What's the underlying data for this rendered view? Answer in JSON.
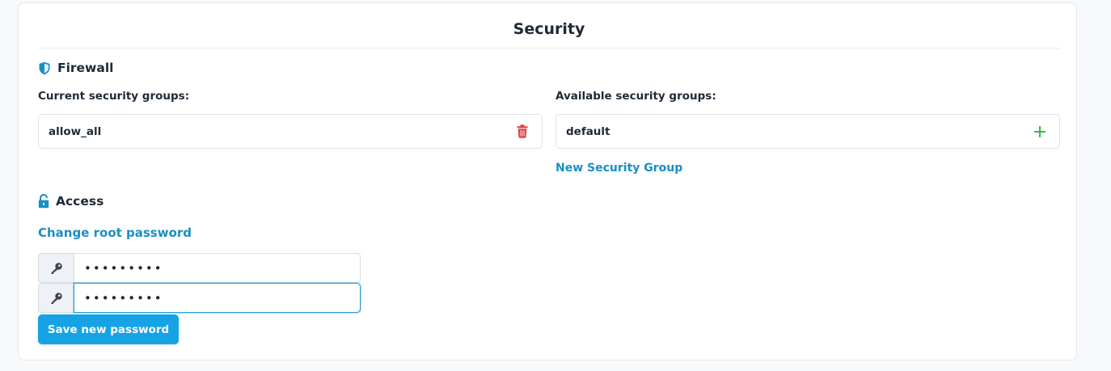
{
  "card": {
    "title": "Security"
  },
  "firewall": {
    "heading": "Firewall",
    "heading_icon": "shield-icon",
    "current_label": "Current security groups:",
    "available_label": "Available security groups:",
    "current_groups": [
      {
        "name": "allow_all",
        "action_icon": "trash-icon"
      }
    ],
    "available_groups": [
      {
        "name": "default",
        "action_icon": "plus-icon"
      }
    ],
    "new_group_link": "New Security Group"
  },
  "access": {
    "heading": "Access",
    "heading_icon": "unlock-icon",
    "change_password_link": "Change root password",
    "password_value": "•••••••••",
    "confirm_value": "•••••••••",
    "field_icon": "key-icon",
    "save_label": "Save new password"
  },
  "colors": {
    "accent": "#16a3e6",
    "link": "#1a8fc4",
    "danger": "#e53e3e",
    "success": "#38b449"
  }
}
